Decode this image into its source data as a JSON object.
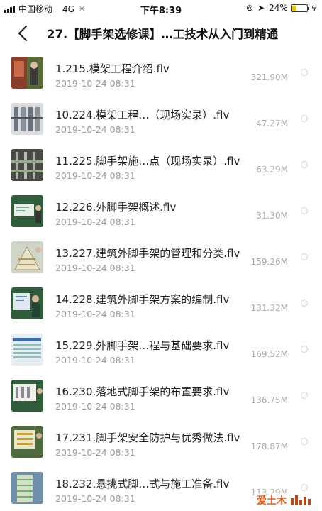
{
  "status_bar": {
    "carrier": "中国移动",
    "network": "4G",
    "time": "下午8:39",
    "battery": "24%",
    "battery_level": 0.24
  },
  "header": {
    "title": "27.【脚手架选修课】…工技术从入门到精通",
    "back_icon": "chevron-left-icon"
  },
  "files": [
    {
      "name": "1.215.模架工程介绍.flv",
      "date": "2019-10-24 08:31",
      "size": "321.90M"
    },
    {
      "name": "10.224.模架工程…（现场实录）.flv",
      "date": "2019-10-24 08:31",
      "size": "47.27M"
    },
    {
      "name": "11.225.脚手架施…点（现场实录）.flv",
      "date": "2019-10-24 08:31",
      "size": "63.29M"
    },
    {
      "name": "12.226.外脚手架概述.flv",
      "date": "2019-10-24 08:31",
      "size": "31.30M"
    },
    {
      "name": "13.227.建筑外脚手架的管理和分类.flv",
      "date": "2019-10-24 08:31",
      "size": "159.26M"
    },
    {
      "name": "14.228.建筑外脚手架方案的编制.flv",
      "date": "2019-10-24 08:31",
      "size": "131.32M"
    },
    {
      "name": "15.229.外脚手架…程与基础要求.flv",
      "date": "2019-10-24 08:31",
      "size": "169.52M"
    },
    {
      "name": "16.230.落地式脚手架的布置要求.flv",
      "date": "2019-10-24 08:31",
      "size": "136.75M"
    },
    {
      "name": "17.231.脚手架安全防护与优秀做法.flv",
      "date": "2019-10-24 08:31",
      "size": "178.87M"
    },
    {
      "name": "18.232.悬挑式脚…式与施工准备.flv",
      "date": "2019-10-24 08:31",
      "size": "113.29M"
    }
  ],
  "watermark": {
    "text": "爱土木"
  }
}
